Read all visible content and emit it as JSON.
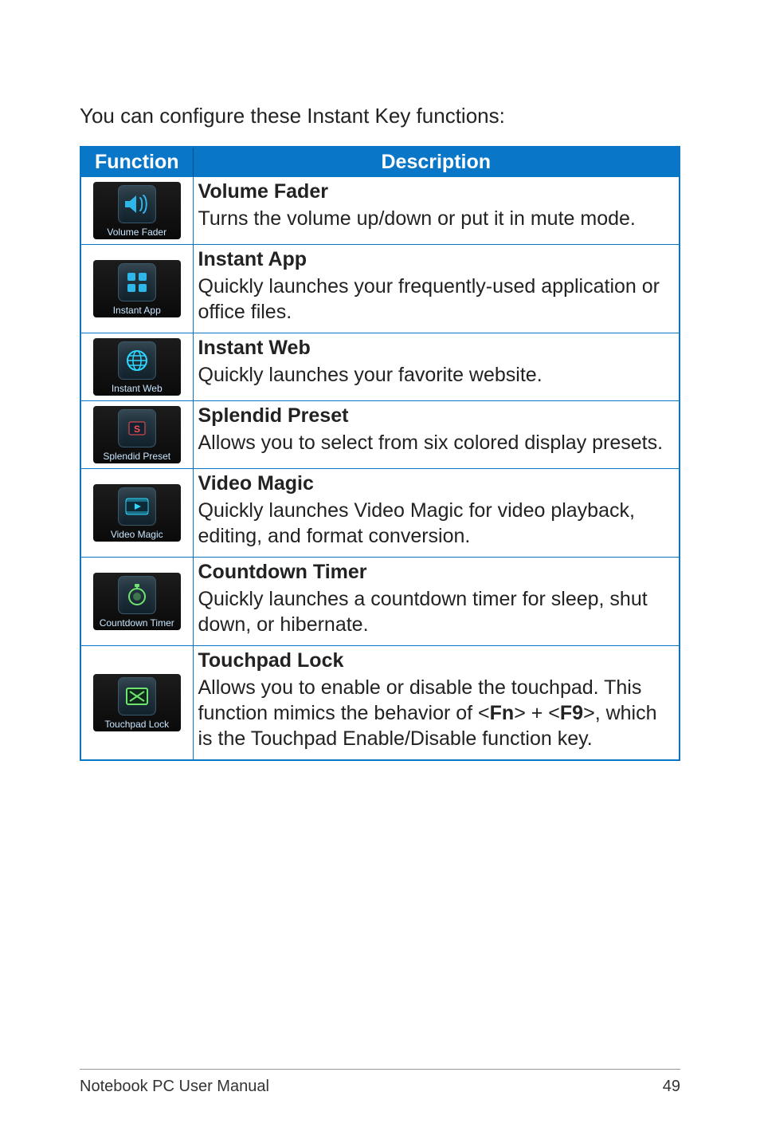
{
  "intro": "You can configure these Instant Key functions:",
  "headers": {
    "function": "Function",
    "description": "Description"
  },
  "rows": [
    {
      "icon_label": "Volume Fader",
      "icon_name": "volume-icon",
      "title": "Volume Fader",
      "body": "Turns the volume up/down or put it in mute mode."
    },
    {
      "icon_label": "Instant App",
      "icon_name": "apps-icon",
      "title": "Instant App",
      "body": "Quickly launches your frequently-used application or office files."
    },
    {
      "icon_label": "Instant Web",
      "icon_name": "globe-icon",
      "title": "Instant Web",
      "body": "Quickly launches your favorite website."
    },
    {
      "icon_label": "Splendid Preset",
      "icon_name": "preset-icon",
      "title": "Splendid Preset",
      "body": "Allows you to select from six colored display presets."
    },
    {
      "icon_label": "Video Magic",
      "icon_name": "video-icon",
      "title": "Video Magic",
      "body": "Quickly launches Video Magic for video playback, editing, and format conversion."
    },
    {
      "icon_label": "Countdown Timer",
      "icon_name": "timer-icon",
      "title": "Countdown Timer",
      "body": "Quickly launches a countdown timer for sleep, shut down, or hibernate."
    },
    {
      "icon_label": "Touchpad Lock",
      "icon_name": "touchpad-lock-icon",
      "title": "Touchpad Lock",
      "body_html": true,
      "body_pre": "Allows you to enable or disable the touchpad. This function mimics the behavior of <",
      "fn": "Fn",
      "body_mid": "> + <",
      "f9": "F9",
      "body_post": ">, which is the Touchpad Enable/Disable function key."
    }
  ],
  "footer": {
    "left": "Notebook PC User Manual",
    "right": "49"
  }
}
